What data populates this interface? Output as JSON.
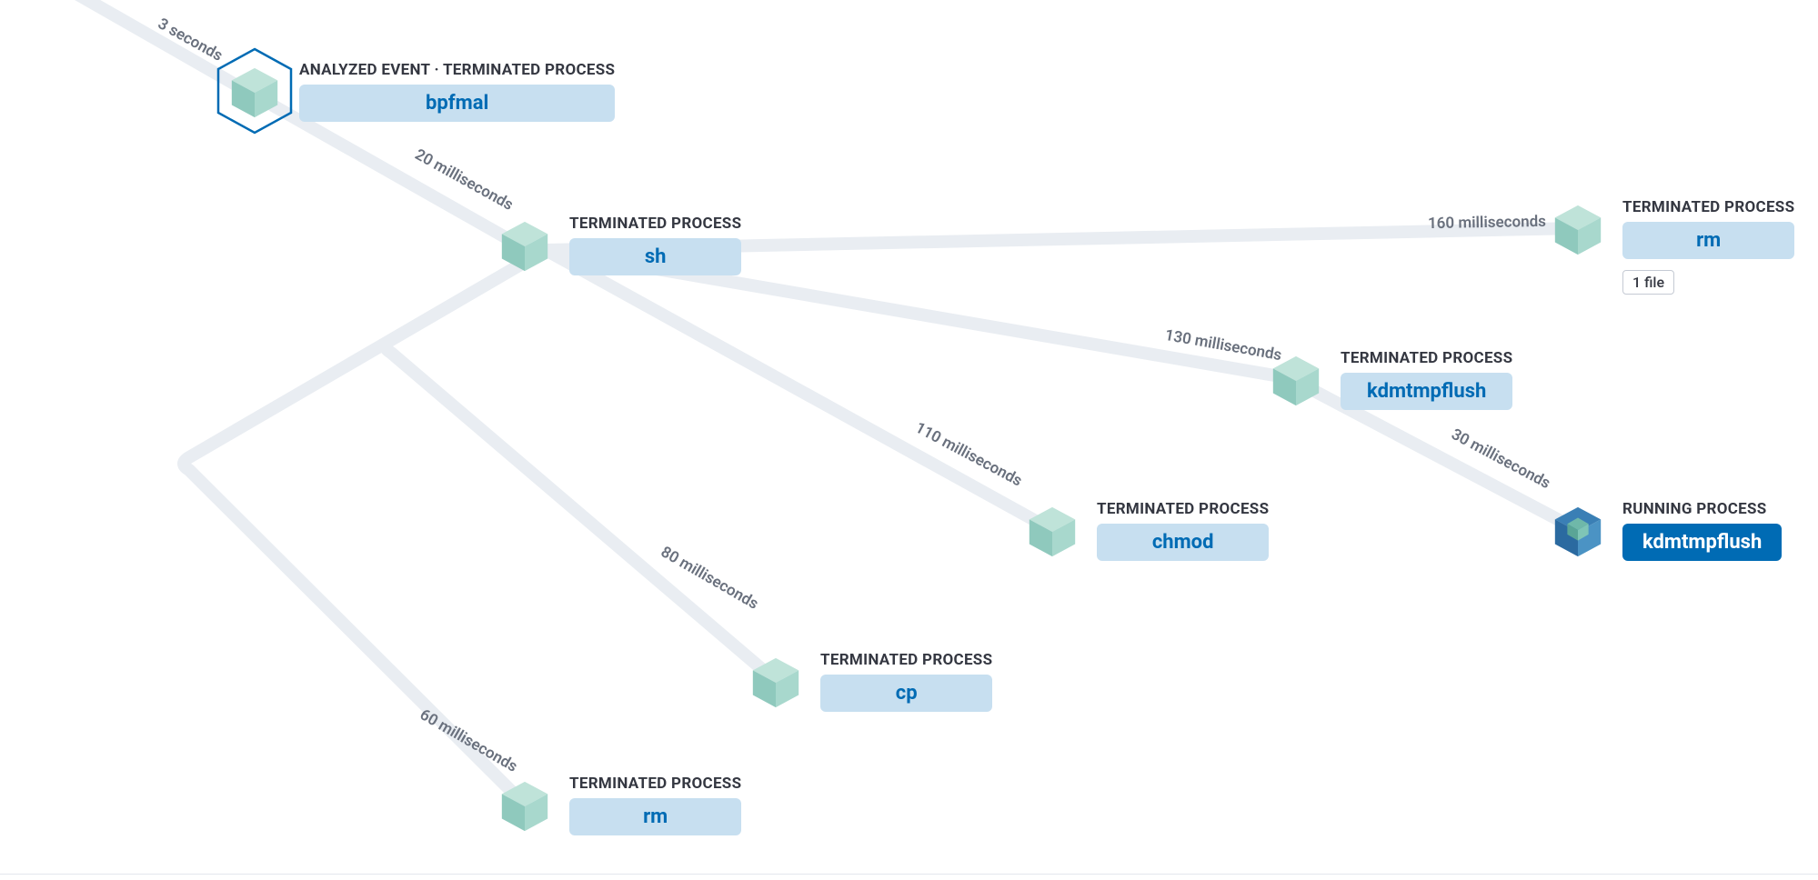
{
  "nodes": {
    "root": {
      "caption": "ANALYZED EVENT · TERMINATED PROCESS",
      "name": "bpfmal",
      "analyzed": true,
      "state": "terminated"
    },
    "sh": {
      "caption": "TERMINATED PROCESS",
      "name": "sh",
      "state": "terminated"
    },
    "rm2": {
      "caption": "TERMINATED PROCESS",
      "name": "rm",
      "state": "terminated"
    },
    "cp": {
      "caption": "TERMINATED PROCESS",
      "name": "cp",
      "state": "terminated"
    },
    "chmod": {
      "caption": "TERMINATED PROCESS",
      "name": "chmod",
      "state": "terminated"
    },
    "kdm1": {
      "caption": "TERMINATED PROCESS",
      "name": "kdmtmpflush",
      "state": "terminated"
    },
    "rm1": {
      "caption": "TERMINATED PROCESS",
      "name": "rm",
      "badge": "1 file",
      "state": "terminated"
    },
    "kdm2": {
      "caption": "RUNNING PROCESS",
      "name": "kdmtmpflush",
      "state": "running"
    }
  },
  "edges": {
    "e_root_in": {
      "label": "3 seconds"
    },
    "e_root_sh": {
      "label": "20 milliseconds"
    },
    "e_sh_rm2": {
      "label": "60 milliseconds"
    },
    "e_sh_cp": {
      "label": "80 milliseconds"
    },
    "e_sh_chmod": {
      "label": "110 milliseconds"
    },
    "e_sh_kdm1": {
      "label": "130 milliseconds"
    },
    "e_sh_rm1": {
      "label": "160 milliseconds"
    },
    "e_kdm1_kdm2": {
      "label": "30 milliseconds"
    }
  }
}
